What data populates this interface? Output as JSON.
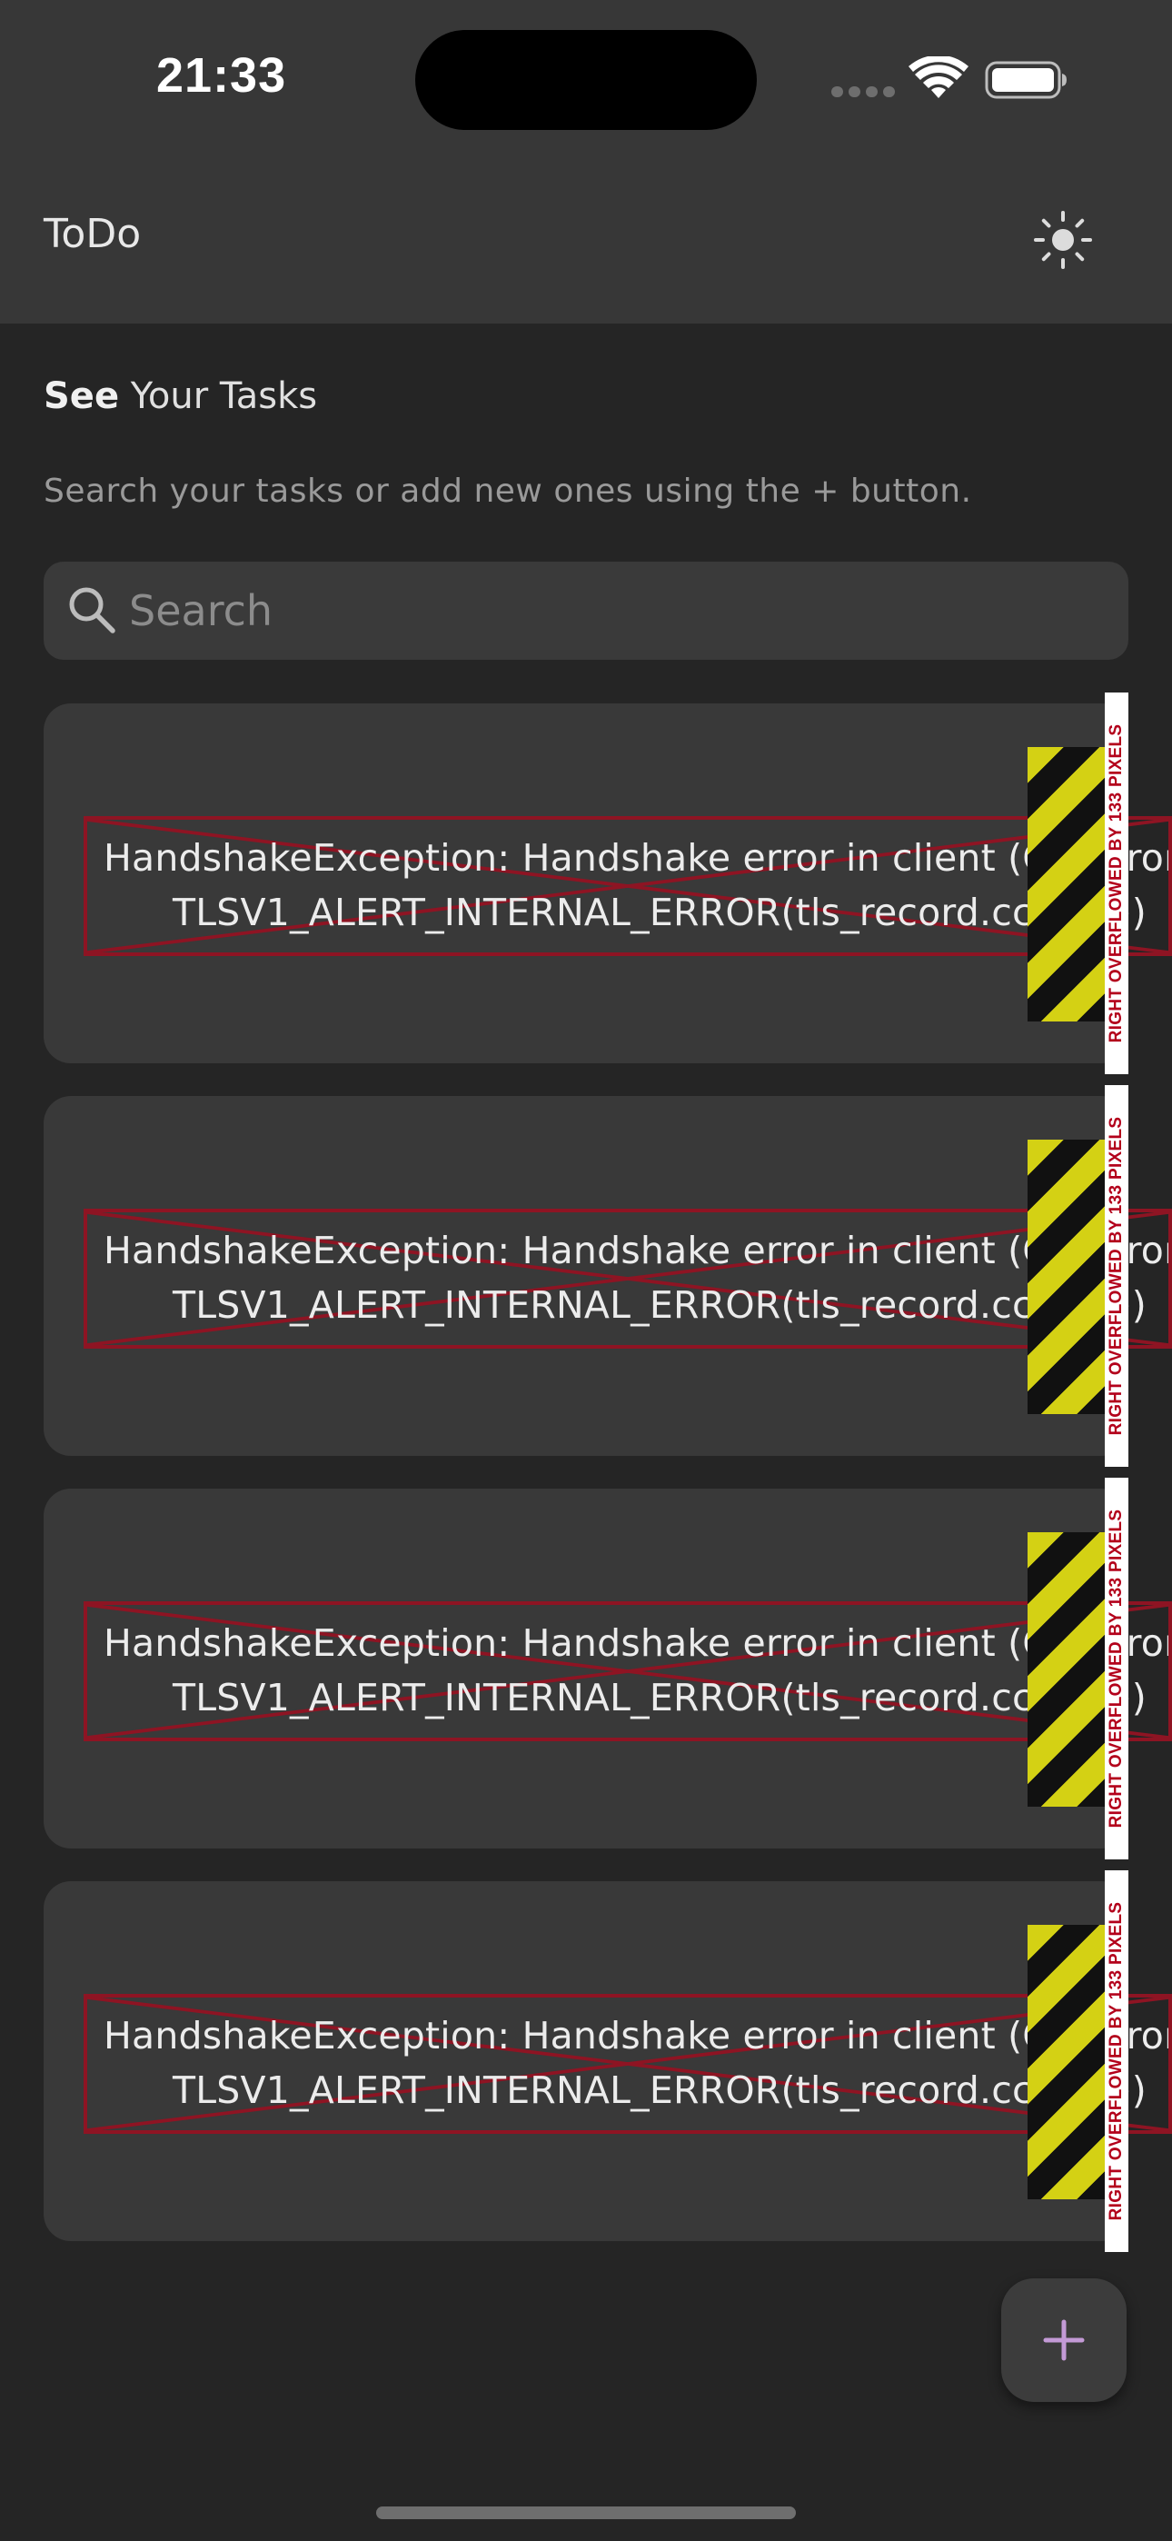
{
  "status_bar": {
    "time": "21:33",
    "signal_icon": "signal-dots-icon",
    "wifi_icon": "wifi-icon",
    "battery_icon": "battery-icon"
  },
  "app_bar": {
    "title": "ToDo",
    "theme_toggle_icon": "sun-icon"
  },
  "header": {
    "title_bold": "See",
    "title_rest": " Your Tasks",
    "subtitle": "Search your tasks or add new ones using the + button."
  },
  "search": {
    "placeholder": "Search",
    "icon": "search-icon"
  },
  "tasks": [
    {
      "error_line1": "HandshakeException: Handshake error in client (OS Error:",
      "error_line2": "TLSV1_ALERT_INTERNAL_ERROR(tls_record.cc:633))",
      "overflow_label": "RIGHT OVERFLOWED BY 133 PIXELS"
    },
    {
      "error_line1": "HandshakeException: Handshake error in client (OS Error:",
      "error_line2": "TLSV1_ALERT_INTERNAL_ERROR(tls_record.cc:633))",
      "overflow_label": "RIGHT OVERFLOWED BY 133 PIXELS"
    },
    {
      "error_line1": "HandshakeException: Handshake error in client (OS Error:",
      "error_line2": "TLSV1_ALERT_INTERNAL_ERROR(tls_record.cc:633))",
      "overflow_label": "RIGHT OVERFLOWED BY 133 PIXELS"
    },
    {
      "error_line1": "HandshakeException: Handshake error in client (OS Error:",
      "error_line2": "TLSV1_ALERT_INTERNAL_ERROR(tls_record.cc:633))",
      "overflow_label": "RIGHT OVERFLOWED BY 133 PIXELS"
    }
  ],
  "fab": {
    "icon": "plus-icon",
    "accent_color": "#c39ad6"
  },
  "colors": {
    "background": "#252525",
    "app_bar": "#373737",
    "card": "#393939",
    "overflow_stripe_yellow": "#d4d114",
    "overflow_border": "#8e1423",
    "overflow_text": "#b3001b"
  }
}
